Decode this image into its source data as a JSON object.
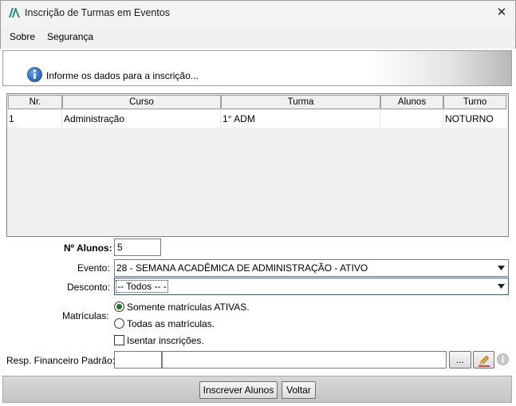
{
  "window": {
    "title": "Inscrição de Turmas em Eventos",
    "close_label": "✕"
  },
  "menu": [
    "Sobre",
    "Segurança"
  ],
  "info": {
    "message": "Informe os dados para a inscrição..."
  },
  "table": {
    "columns": [
      "Nr.",
      "Curso",
      "Turma",
      "Alunos",
      "Turno"
    ],
    "rows": [
      [
        "1",
        "Administração",
        "1° ADM",
        "",
        "NOTURNO"
      ]
    ]
  },
  "form": {
    "num_alunos_label": "Nº Alunos:",
    "num_alunos_value": "5",
    "evento_label": "Evento:",
    "evento_value": "28 - SEMANA ACADÊMICA DE ADMINISTRAÇÃO - ATIVO",
    "desconto_label": "Desconto:",
    "desconto_value": "-- Todos -- -",
    "matriculas_label": "Matrículas:",
    "matriculas_options": [
      "Somente matrículas ATIVAS.",
      "Todas as matrículas."
    ],
    "matriculas_selected": 0,
    "isentar_label": "Isentar inscrições.",
    "isentar_checked": false,
    "resp_label": "Resp. Financeiro Padrão:",
    "resp_code": "",
    "resp_name": "",
    "browse_label": "..."
  },
  "buttons": {
    "inscrever": "Inscrever Alunos",
    "voltar": "Voltar"
  },
  "colors": {
    "info_icon": "#1e5fb4",
    "logo": "#1f8c7a",
    "radio_dot": "#1a7d1a",
    "focus_border": "#1c5fb0"
  }
}
